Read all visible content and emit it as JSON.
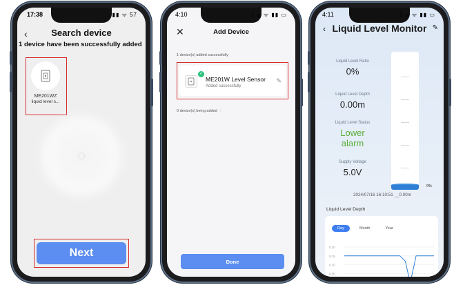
{
  "colors": {
    "accent": "#5b8ef0",
    "highlight_box": "#d62c2c",
    "alarm_text": "#5aae3a",
    "success": "#2bc37e",
    "water": "#2f7fd4"
  },
  "phone1": {
    "status": {
      "time": "17:38",
      "icons": "▮▮ ᯤ 57"
    },
    "back_icon": "back-arrow-icon",
    "title": "Search device",
    "subtitle": "1 device have been successfully added",
    "device": {
      "name": "ME201WZ",
      "desc": "liquid level s..."
    },
    "button_label": "Next"
  },
  "phone2": {
    "status": {
      "time": "4:10",
      "icons": "ᛒ ⓝ ᯤ ▮▮ ▭"
    },
    "close_icon": "close-icon",
    "title": "Add Device",
    "added_text": "1 device(s) added successfully",
    "device": {
      "name": "ME201W Level Sensor",
      "status": "Added successfully"
    },
    "adding_text": "0 device(s) being added",
    "button_label": "Done"
  },
  "phone3": {
    "status": {
      "time": "4:11",
      "icons": "ᛒ ⓝ ᯤ ▮▮ ▭"
    },
    "title": "Liquid Level Monitor",
    "metrics": [
      {
        "label": "Liquid Level Ratio",
        "value": "0%"
      },
      {
        "label": "Liquid Level Depth",
        "value": "0.00m"
      },
      {
        "label": "Liquid Level Status",
        "value": "Lower alarm"
      },
      {
        "label": "Supply Voltage",
        "value": "5.0V"
      }
    ],
    "tank_fill_fraction": 0.0,
    "tank_percent_label": "0%",
    "timestamp": "2024/07/16 16:10:51 __0.00m",
    "chart_title": "Liquid Level Depth",
    "tabs": [
      "Day",
      "Month",
      "Year"
    ],
    "active_tab": "Day"
  },
  "chart_data": {
    "type": "line",
    "title": "Liquid Level Depth",
    "xlabel": "",
    "ylabel": "",
    "y_ticks": [
      "0.20",
      "0.15",
      "0.10",
      "0.05"
    ],
    "ylim": [
      0,
      0.22
    ],
    "grid": true,
    "series": [
      {
        "x": [
          0,
          0.55,
          0.62,
          0.68,
          0.72,
          0.74,
          0.78,
          0.8,
          0.84,
          0.88,
          1.0
        ],
        "values": [
          0.15,
          0.15,
          0.15,
          0.12,
          0.03,
          0.01,
          0.1,
          0.15,
          0.15,
          0.15,
          0.15
        ]
      }
    ]
  }
}
